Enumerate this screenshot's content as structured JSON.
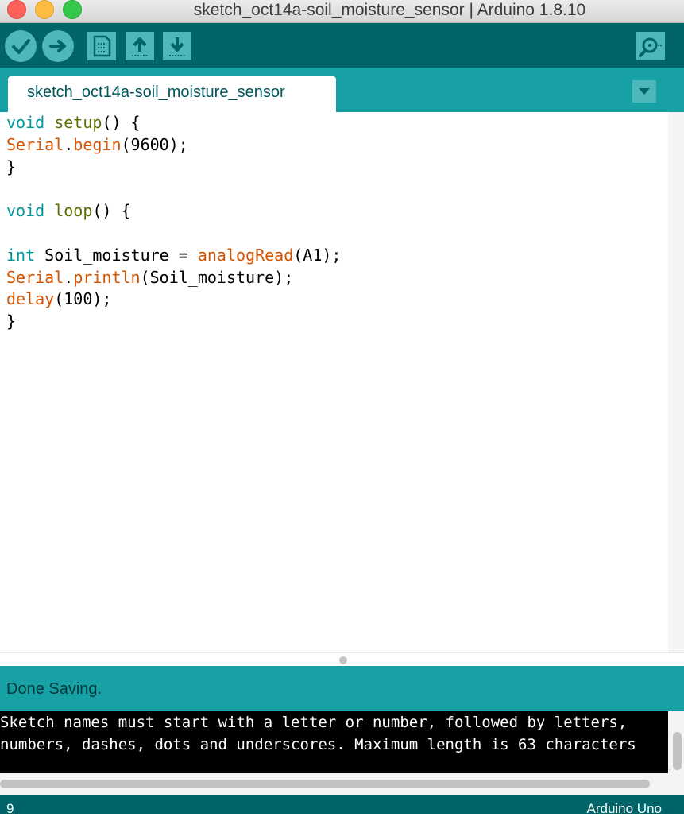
{
  "window": {
    "title": "sketch_oct14a-soil_moisture_sensor | Arduino 1.8.10"
  },
  "toolbar": {
    "buttons": [
      {
        "icon": "checkmark-icon",
        "tooltip": "Verify"
      },
      {
        "icon": "arrow-right-icon",
        "tooltip": "Upload"
      },
      {
        "icon": "new-document-icon",
        "tooltip": "New"
      },
      {
        "icon": "arrow-up-icon",
        "tooltip": "Open"
      },
      {
        "icon": "arrow-down-icon",
        "tooltip": "Save"
      },
      {
        "icon": "magnifier-icon",
        "tooltip": "Serial Monitor"
      }
    ]
  },
  "tab": {
    "label": "sketch_oct14a-soil_moisture_sensor"
  },
  "code": {
    "lines": [
      [
        {
          "t": "void",
          "c": "kw"
        },
        {
          "t": " "
        },
        {
          "t": "setup",
          "c": "fn"
        },
        {
          "t": "() {"
        }
      ],
      [
        {
          "t": "Serial",
          "c": "obj"
        },
        {
          "t": "."
        },
        {
          "t": "begin",
          "c": "meth"
        },
        {
          "t": "(9600);"
        }
      ],
      [
        {
          "t": "}"
        }
      ],
      [
        {
          "t": ""
        }
      ],
      [
        {
          "t": "void",
          "c": "kw"
        },
        {
          "t": " "
        },
        {
          "t": "loop",
          "c": "fn"
        },
        {
          "t": "() {"
        }
      ],
      [
        {
          "t": ""
        }
      ],
      [
        {
          "t": "int",
          "c": "kw"
        },
        {
          "t": " Soil_moisture = "
        },
        {
          "t": "analogRead",
          "c": "meth"
        },
        {
          "t": "(A1);"
        }
      ],
      [
        {
          "t": "Serial",
          "c": "obj"
        },
        {
          "t": "."
        },
        {
          "t": "println",
          "c": "meth"
        },
        {
          "t": "(Soil_moisture);"
        }
      ],
      [
        {
          "t": "delay",
          "c": "meth"
        },
        {
          "t": "(100);"
        }
      ],
      [
        {
          "t": "}"
        }
      ]
    ]
  },
  "status": {
    "message": "Done Saving."
  },
  "console": {
    "lines": [
      "Sketch names must start with a letter or number, followed by letters,",
      "numbers, dashes, dots and underscores. Maximum length is 63 characters"
    ]
  },
  "footer": {
    "line_number": "9",
    "board": "Arduino Uno"
  },
  "colors": {
    "toolbar": "#006468",
    "tabbar": "#17a1a5",
    "button": "#4db7bb",
    "keyword": "#00979c",
    "function": "#5e6d03",
    "library": "#d35400"
  }
}
